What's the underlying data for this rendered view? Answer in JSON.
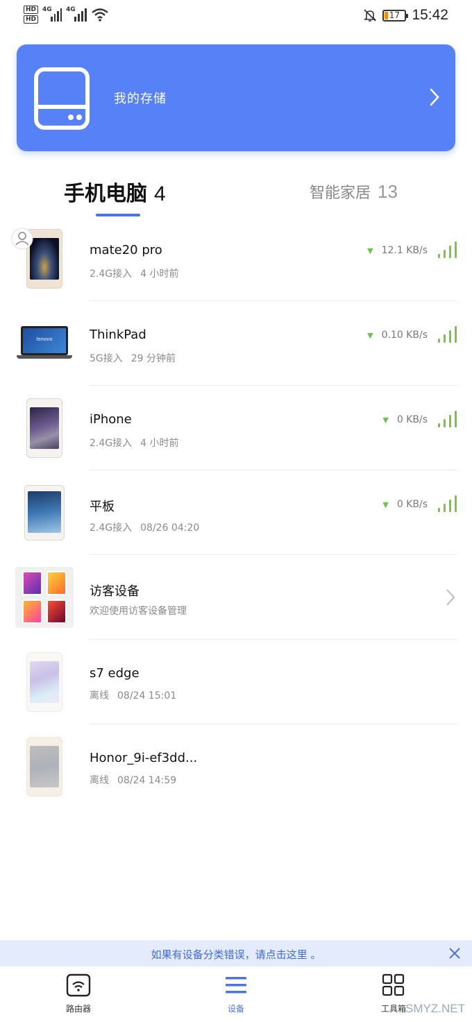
{
  "status_bar": {
    "hd_badges": [
      "HD",
      "HD"
    ],
    "network_labels": [
      "4G",
      "4G"
    ],
    "battery": "17",
    "time": "15:42",
    "icons": [
      "signal-icon",
      "wifi-icon",
      "mute-bell-icon",
      "battery-icon"
    ]
  },
  "storage": {
    "title": "我的存储",
    "icon": "hard-drive-icon"
  },
  "tabs": [
    {
      "label": "手机电脑",
      "count": "4",
      "active": true
    },
    {
      "label": "智能家居",
      "count": "13",
      "active": false
    }
  ],
  "devices": [
    {
      "name": "mate20 pro",
      "band": "2.4G接入",
      "time": "4 小时前",
      "speed": "12.1 KB/s",
      "online": true,
      "owner_badge": true
    },
    {
      "name": "ThinkPad",
      "band": "5G接入",
      "time": "29 分钟前",
      "speed": "0.10 KB/s",
      "online": true,
      "laptop_brand": "lenovo"
    },
    {
      "name": "iPhone",
      "band": "2.4G接入",
      "time": "4 小时前",
      "speed": "0 KB/s",
      "online": true
    },
    {
      "name": "平板",
      "band": "2.4G接入",
      "time": "08/26 04:20",
      "speed": "0 KB/s",
      "online": true
    },
    {
      "name": "访客设备",
      "description": "欢迎使用访客设备管理",
      "type": "guest"
    },
    {
      "name": "s7 edge",
      "band": "离线",
      "time": "08/24 15:01",
      "online": false
    },
    {
      "name": "Honor_9i-ef3dd...",
      "band": "离线",
      "time": "08/24 14:59",
      "online": false
    }
  ],
  "notice": {
    "text": "如果有设备分类错误，请点击这里 。"
  },
  "bottom_nav": [
    {
      "label": "路由器",
      "icon": "router-icon",
      "active": false
    },
    {
      "label": "设备",
      "icon": "list-icon",
      "active": true
    },
    {
      "label": "工具箱",
      "icon": "grid-icon",
      "active": false
    }
  ],
  "watermark": "SMYZ.NET",
  "colors": {
    "accent": "#5781f7",
    "tab_active": "#4c73e0",
    "signal_green": "#7cc544",
    "notice_bg": "#e3ebfc"
  }
}
